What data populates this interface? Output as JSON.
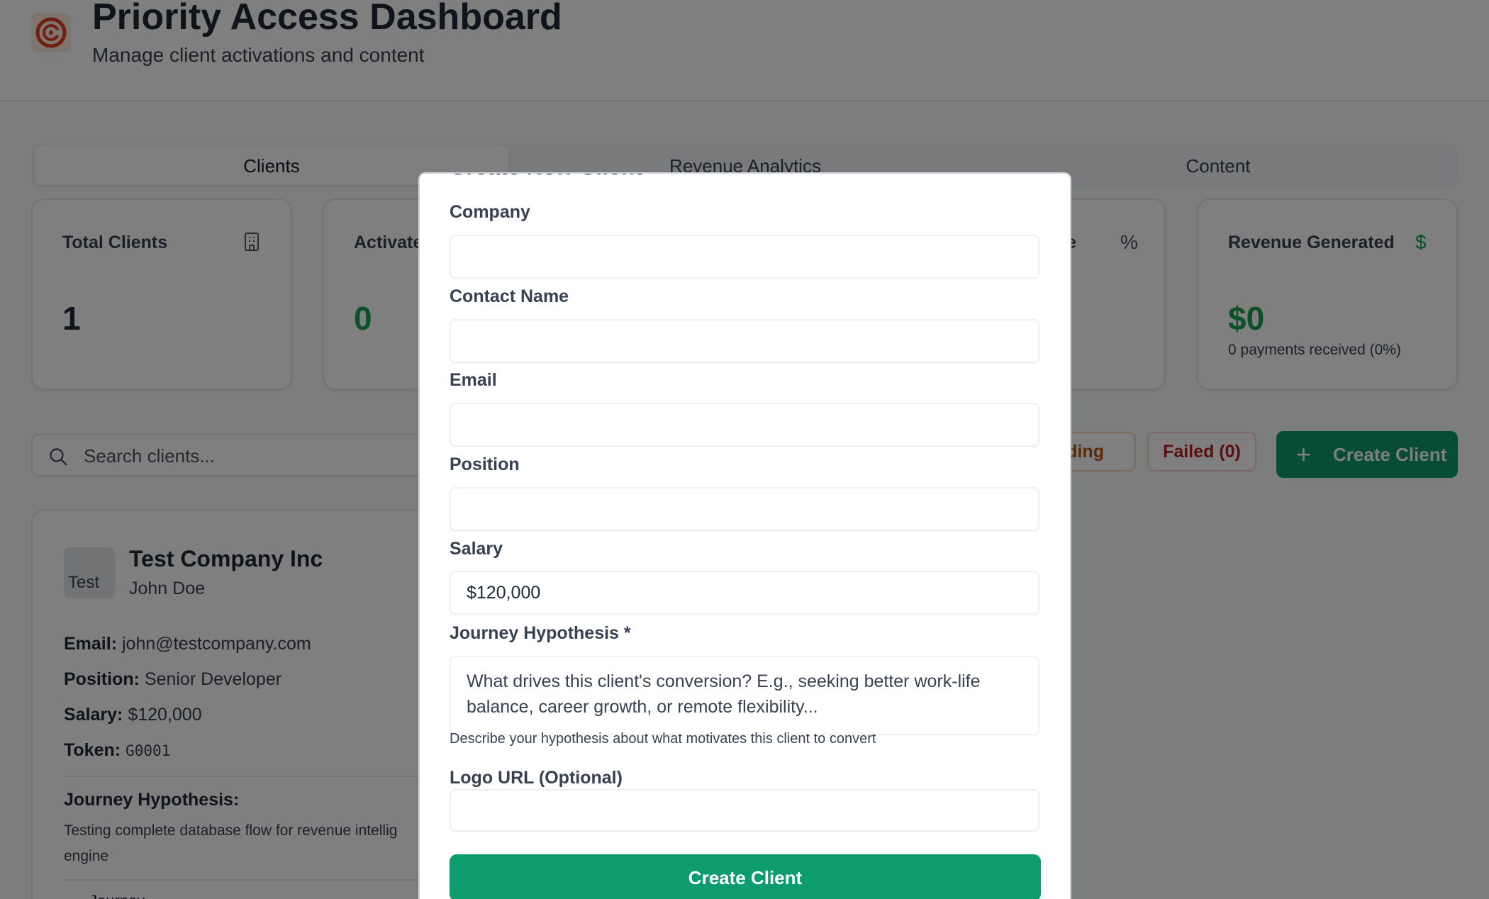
{
  "header": {
    "title": "Priority Access Dashboard",
    "subtitle": "Manage client activations and content"
  },
  "tabs": [
    {
      "label": "Clients",
      "active": true
    },
    {
      "label": "Revenue Analytics",
      "active": false
    },
    {
      "label": "Content",
      "active": false
    }
  ],
  "stats": [
    {
      "label": "Total Clients",
      "value": "1",
      "icon": "building-icon"
    },
    {
      "label": "Activate",
      "value": "0",
      "icon": ""
    },
    {
      "label": "e",
      "icon": "percent-icon",
      "icon_glyph": "%"
    },
    {
      "label": "Revenue Generated",
      "value": "$0",
      "sub": "0 payments received (0%)",
      "icon": "dollar-icon",
      "icon_glyph": "$"
    }
  ],
  "search": {
    "placeholder": "Search clients..."
  },
  "filters": {
    "pending_label": "ending",
    "failed_label": "Failed (0)"
  },
  "create_button": {
    "label": "Create Client",
    "plus": "+"
  },
  "client": {
    "logo_alt": "Test",
    "company": "Test Company Inc",
    "contact": "John Doe",
    "email_label": "Email:",
    "email": "john@testcompany.com",
    "position_label": "Position:",
    "position": "Senior Developer",
    "salary_label": "Salary:",
    "salary": "$120,000",
    "token_label": "Token:",
    "token": "G0001",
    "hypothesis_label": "Journey Hypothesis:",
    "hypothesis": "Testing complete database flow for revenue intellig\nengine",
    "journey_more": "Journey"
  },
  "modal": {
    "title": "Create New Client",
    "fields": {
      "company": {
        "label": "Company",
        "value": ""
      },
      "contact_name": {
        "label": "Contact Name",
        "value": ""
      },
      "email": {
        "label": "Email",
        "value": ""
      },
      "position": {
        "label": "Position",
        "value": ""
      },
      "salary": {
        "label": "Salary",
        "value": "$120,000"
      },
      "journey_hypothesis": {
        "label": "Journey Hypothesis *",
        "placeholder": "What drives this client's conversion? E.g., seeking better work-life balance, career growth, or remote flexibility...",
        "helper": "Describe your hypothesis about what motivates this client to convert"
      },
      "logo_url": {
        "label": "Logo URL (Optional)",
        "value": ""
      }
    },
    "submit_label": "Create Client"
  },
  "colors": {
    "accent_green": "#0c9c6d",
    "value_green": "#16a34a",
    "pending_amber": "#b45309",
    "failed_red": "#b91c1c",
    "logo_red": "#e0431a"
  }
}
